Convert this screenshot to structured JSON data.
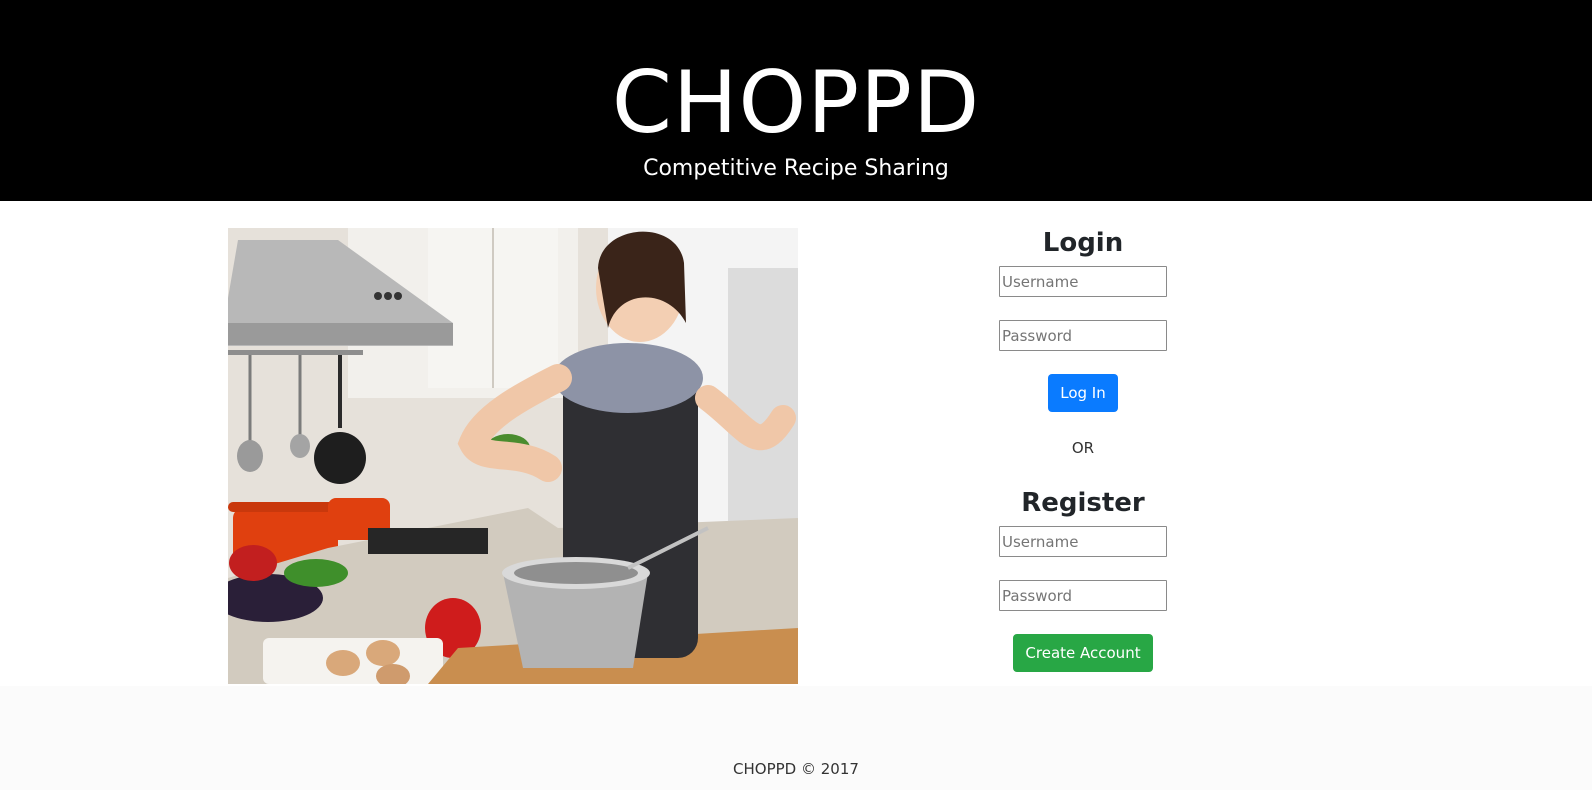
{
  "header": {
    "brand": "CHOPPD",
    "tagline": "Competitive Recipe Sharing"
  },
  "hero": {
    "alt": "Woman cooking in a kitchen, sprinkling salt into a metal bowl"
  },
  "login": {
    "title": "Login",
    "username_placeholder": "Username",
    "password_placeholder": "Password",
    "button": "Log In"
  },
  "divider": "OR",
  "register": {
    "title": "Register",
    "username_placeholder": "Username",
    "password_placeholder": "Password",
    "button": "Create Account"
  },
  "footer": "CHOPPD © 2017",
  "colors": {
    "header_bg": "#000000",
    "login_button": "#0a7bff",
    "register_button": "#28a745"
  }
}
